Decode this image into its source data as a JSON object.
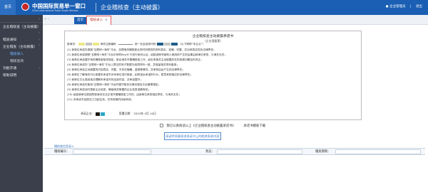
{
  "header": {
    "home_label": "首页",
    "logo_cn": "中国国际贸易单一窗口",
    "logo_en": "China International Trade Single Window",
    "system_title": "企业稽核查（主动披露）",
    "user_label": "企业管理员",
    "exit_label": "退出"
  },
  "sidebar": {
    "toggle": "‹",
    "items": [
      {
        "label": "企业稽核查（主动披露）",
        "arrow": "‹"
      },
      {
        "label": "稽查通知",
        "arrow": "‹"
      },
      {
        "label": "企业稽查（主动披露）",
        "arrow": "˅"
      }
    ],
    "subitems": [
      {
        "label": "稽核录入"
      },
      {
        "label": "稽核查询"
      }
    ],
    "items2": [
      {
        "label": "功能开通",
        "arrow": "‹"
      },
      {
        "label": "帮助说明",
        "arrow": ""
      }
    ]
  },
  "tabs": {
    "nav_arrows": "« ‹",
    "home": "首页",
    "active": "稽核录入",
    "close": "⊗"
  },
  "letter": {
    "title": "企业稽核查主动披露承诺书",
    "subtitle": "（企业理要素）",
    "addressee": "致海关：",
    "mid_field": "海关注册编码",
    "credit_field": "统一社会信用代码",
    "tail_note": "（以下简称“本企业”）",
    "lines": [
      "(1) 我单位承诺在填报“互联网+海关”平台、自理海关稽核查业务时所提供的资料真实、准确、完整，并对其真实性负法律责任；",
      "(2) 我单位承诺按照“互联网+海关”平台中所附Key/IC卡进行身份认证，如因该账号被他人使用所产生的后果由我单位承担，与海关无关；",
      "(3) 我单位承诺遵守海关稽核查相关规定，配合海关开展稽核查工作，如实申报并主动披露存在的违规问题及时改正；",
      "(4) 我单位承诺在“互联网+海关”平台上提交的电子数据与纸质材料一致，并保留相关资料备查；",
      "(5) 我单位承诺主动披露的内容真实、完整，不存在隐瞒、虚报等情况，并承担由此产生的法律责任；",
      "(6) 我单位了解海关可以依据本承诺书对本单位进行核查，如有违反承诺的行为，愿意承担相应的法律责任；",
      "(7) 我单位已认真阅读并理解本承诺书的全部内容，并承诺遵守；",
      "(8) 我单位承诺在使用“互联网+海关”平台时遵守相关法律法规及平台管理规定；",
      "(9) 我单位承诺及时更新企业信息，确保海关掌握的企业信息准确有效；",
      "(10) 如因我单位原因导致海关无法正常开展稽核查工作的，由我单位承担相应责任，与海关无关；",
      "(11) 本承诺书自提交之日起生效，在有效期内持续有效。"
    ],
    "signer_label": "承诺企业：",
    "date_label": "签署日期：",
    "date_value": "2024年  4月  10日"
  },
  "agree": {
    "checkbox_label": "我已认真阅读以上《企业稽核查主动披露承诺书》",
    "download_label": "承诺书模板下载"
  },
  "submit_label": "阅读并同意前述承诺书上的相关条款内容",
  "section_link": "稽核查信息录入",
  "table": {
    "col1": "稽核编号：",
    "col2": "状态：",
    "col3": "稽查期限："
  }
}
